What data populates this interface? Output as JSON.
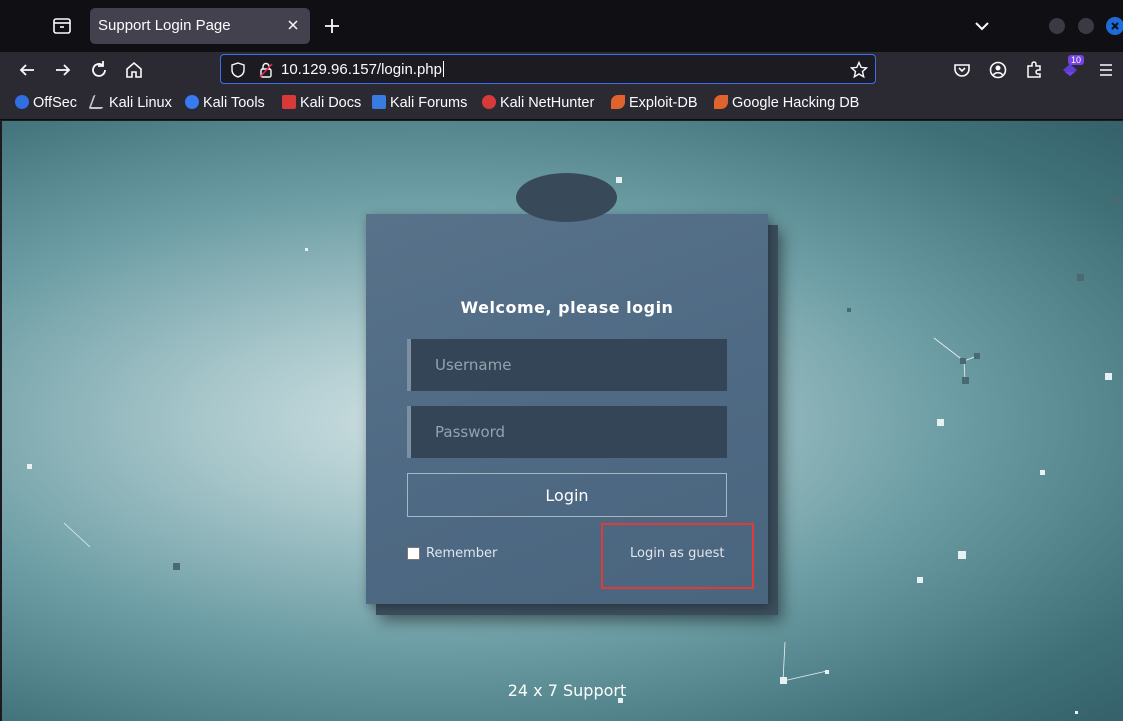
{
  "browser": {
    "tab": {
      "title": "Support Login Page"
    },
    "url": "10.129.96.157/login.php",
    "extensions_badge": "10"
  },
  "bookmarks": [
    {
      "label": "OffSec",
      "icon": "offsec-icon",
      "color": "#2f6fe0"
    },
    {
      "label": "Kali Linux",
      "icon": "kali-linux-icon",
      "color": "#bfc5cc"
    },
    {
      "label": "Kali Tools",
      "icon": "kali-tools-icon",
      "color": "#367bf0"
    },
    {
      "label": "Kali Docs",
      "icon": "kali-docs-icon",
      "color": "#d83a3a"
    },
    {
      "label": "Kali Forums",
      "icon": "kali-forums-icon",
      "color": "#3a7be0"
    },
    {
      "label": "Kali NetHunter",
      "icon": "kali-nethunter-icon",
      "color": "#d83a3a"
    },
    {
      "label": "Exploit-DB",
      "icon": "exploit-db-icon",
      "color": "#e0632e"
    },
    {
      "label": "Google Hacking DB",
      "icon": "ghdb-icon",
      "color": "#e0632e"
    }
  ],
  "login": {
    "welcome": "Welcome, please login",
    "username_placeholder": "Username",
    "password_placeholder": "Password",
    "login_button": "Login",
    "remember_label": "Remember",
    "guest_link": "Login as guest"
  },
  "footer": {
    "support": "24 x 7 Support"
  },
  "colors": {
    "highlight_box": "#e03b3b",
    "url_focus": "#3d6ef0"
  }
}
